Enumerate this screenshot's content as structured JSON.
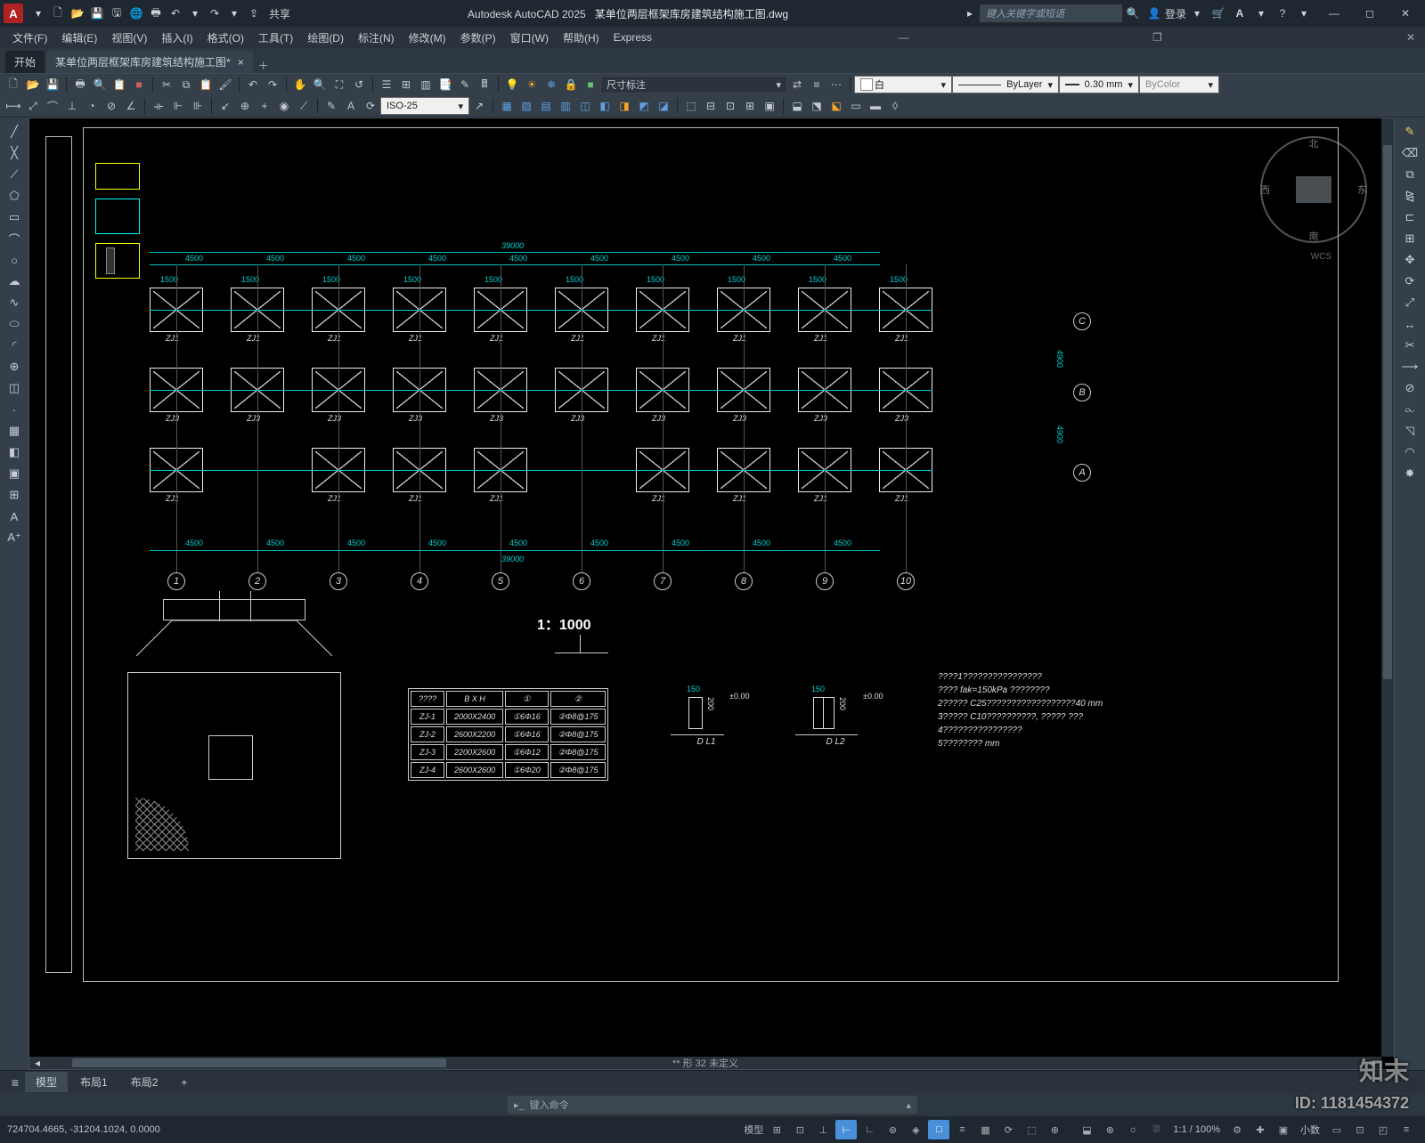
{
  "app": {
    "name": "Autodesk AutoCAD 2025",
    "file": "某单位两层框架库房建筑结构施工图.dwg"
  },
  "titlebar": {
    "share": "共享",
    "search_placeholder": "键入关键字或短语",
    "login": "登录"
  },
  "menu": {
    "items": [
      "文件(F)",
      "编辑(E)",
      "视图(V)",
      "插入(I)",
      "格式(O)",
      "工具(T)",
      "绘图(D)",
      "标注(N)",
      "修改(M)",
      "参数(P)",
      "窗口(W)",
      "帮助(H)",
      "Express"
    ]
  },
  "doctabs": {
    "home": "开始",
    "active": "某单位两层框架库房建筑结构施工图*"
  },
  "ribbon": {
    "dimstyle": "尺寸标注",
    "layer": "白",
    "linetype": "ByLayer",
    "lineweight": "0.30 mm",
    "color": "ByColor",
    "iso": "ISO-25"
  },
  "compass": {
    "n": "北",
    "e": "东",
    "s": "南",
    "w": "西",
    "wcs": "WCS"
  },
  "drawing": {
    "scale": "1：1000",
    "grid_h": [
      "1",
      "2",
      "3",
      "4",
      "5",
      "6",
      "7",
      "8",
      "9",
      "10"
    ],
    "grid_v": [
      "A",
      "B",
      "C"
    ],
    "span": "4500",
    "total_h": "39000",
    "vspan": "4900",
    "foot_size": "1500",
    "zj": "ZJ1",
    "zj2": "ZJ2",
    "zj3": "ZJ3",
    "zj4": "ZJ4",
    "dl": "DL1",
    "dl2": "DL2",
    "dl_sec_a": "D L1",
    "dl_sec_b": "D L2",
    "elev": "±0.00",
    "fsize1": "150",
    "fsize2": "200"
  },
  "table": {
    "head": [
      "????",
      "B X H",
      "①",
      "②"
    ],
    "rows": [
      [
        "ZJ-1",
        "2000X2400",
        "①6Φ16",
        "②Φ8@175"
      ],
      [
        "ZJ-2",
        "2600X2200",
        "①6Φ16",
        "②Φ8@175"
      ],
      [
        "ZJ-3",
        "2200X2600",
        "①6Φ12",
        "②Φ8@175"
      ],
      [
        "ZJ-4",
        "2600X2600",
        "①6Φ20",
        "②Φ8@175"
      ]
    ]
  },
  "notes": {
    "l0": "????1????????????????",
    "l1": "???? fak=150kPa ????????",
    "l2": "2????? C25??????????????????40 mm",
    "l3": "3????? C10??????????,  ????? ???",
    "l4": "4????????????????",
    "l5": "5???????? mm"
  },
  "cmd": {
    "prompt": "键入命令",
    "form_label": "** 形 32 未定义"
  },
  "sheets": {
    "model": "模型",
    "l1": "布局1",
    "l2": "布局2"
  },
  "status": {
    "coords": "724704.4665, -31204.1024, 0.0000",
    "model": "模型",
    "scale": "1:1 / 100%",
    "dec": "小数"
  },
  "watermark": "知末",
  "id": "ID: 1181454372"
}
